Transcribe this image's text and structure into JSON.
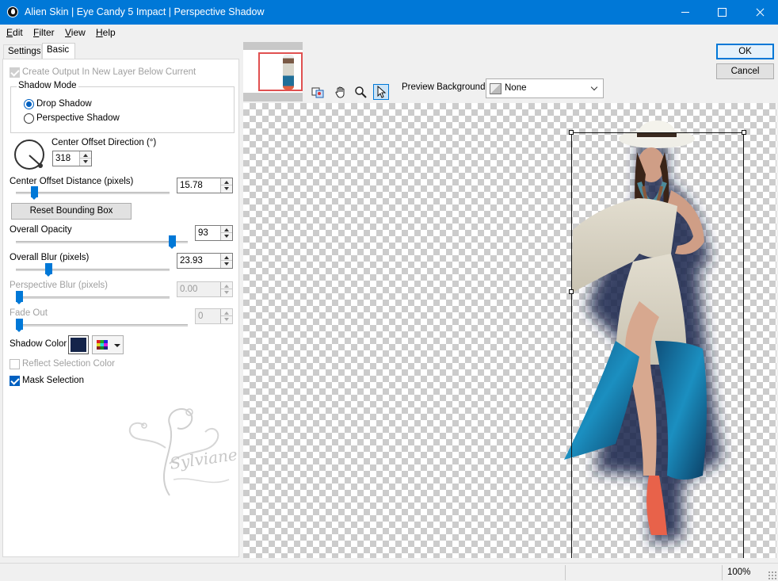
{
  "window": {
    "title": "Alien Skin | Eye Candy 5 Impact | Perspective Shadow"
  },
  "menu": [
    {
      "first": "E",
      "rest": "dit"
    },
    {
      "first": "F",
      "rest": "ilter"
    },
    {
      "first": "V",
      "rest": "iew"
    },
    {
      "first": "H",
      "rest": "elp"
    }
  ],
  "tabs": {
    "settings": "Settings",
    "basic": "Basic"
  },
  "basic": {
    "create_output_label": "Create Output In New Layer Below Current",
    "shadow_mode": {
      "title": "Shadow Mode",
      "drop_shadow": "Drop Shadow",
      "perspective_shadow": "Perspective Shadow",
      "selected": "Drop Shadow"
    },
    "center_offset_direction": {
      "label": "Center Offset Direction (°)",
      "value": "318"
    },
    "center_offset_distance": {
      "label": "Center Offset Distance (pixels)",
      "value": "15.78",
      "slider_fraction": 0.1
    },
    "reset_bounding_box": "Reset Bounding Box",
    "overall_opacity": {
      "label": "Overall Opacity",
      "value": "93",
      "slider_fraction": 0.93
    },
    "overall_blur": {
      "label": "Overall Blur (pixels)",
      "value": "23.93",
      "slider_fraction": 0.2
    },
    "perspective_blur": {
      "label": "Perspective Blur (pixels)",
      "value": "0.00",
      "slider_fraction": 0
    },
    "fade_out": {
      "label": "Fade Out",
      "value": "0",
      "slider_fraction": 0
    },
    "shadow_color": {
      "label": "Shadow Color",
      "color": "#14244a"
    },
    "reflect_selection_color": "Reflect Selection Color",
    "mask_selection": "Mask Selection",
    "signature_text": "Sylviane"
  },
  "preview": {
    "background_label": "Preview Background:",
    "background_value": "None",
    "tools": [
      "before-after-icon",
      "hand-icon",
      "zoom-icon",
      "pointer-icon"
    ]
  },
  "buttons": {
    "ok": "OK",
    "cancel": "Cancel"
  },
  "status": {
    "zoom": "100%"
  },
  "colors": {
    "titlebar": "#0078d7",
    "accent": "#0078d7",
    "shadow": "#14244a"
  }
}
